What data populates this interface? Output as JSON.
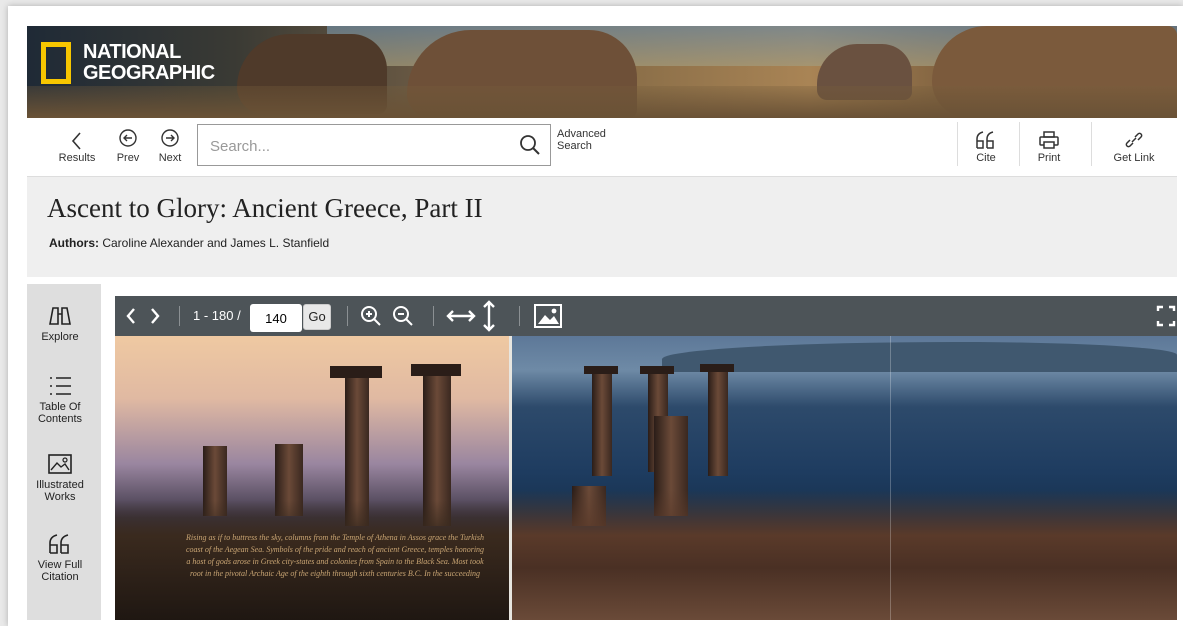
{
  "brand": {
    "line1": "NATIONAL",
    "line2": "GEOGRAPHIC"
  },
  "toolbar": {
    "results_label": "Results",
    "prev_label": "Prev",
    "next_label": "Next",
    "search_placeholder": "Search...",
    "advanced_line1": "Advanced",
    "advanced_line2": "Search",
    "cite_label": "Cite",
    "print_label": "Print",
    "getlink_label": "Get Link"
  },
  "document": {
    "title": "Ascent to Glory: Ancient Greece, Part II",
    "authors_label": "Authors:",
    "authors_value": "Caroline Alexander and James L. Stanfield"
  },
  "sidebar": {
    "items": [
      {
        "label": "Explore"
      },
      {
        "label": "Table Of Contents"
      },
      {
        "label": "Illustrated Works"
      },
      {
        "label": "View Full Citation"
      }
    ]
  },
  "viewer": {
    "range_text": "1 - 180 /",
    "page_value": "140",
    "go_label": "Go",
    "caption": "Rising as if to buttress the sky, columns from the Temple of Athena in Assos grace the Turkish coast of the Aegean Sea. Symbols of the pride and reach of ancient Greece, temples honoring a host of gods arose in Greek city-states and colonies from Spain to the Black Sea. Most took root in the pivotal Archaic Age of the eighth through sixth centuries B.C. In the succeeding"
  },
  "icons": {
    "results": "chevron-left-icon",
    "prev": "circle-arrow-left-icon",
    "next": "circle-arrow-right-icon",
    "search": "magnifier-icon",
    "cite": "quote-icon",
    "print": "printer-icon",
    "getlink": "link-icon",
    "explore": "binoculars-icon",
    "toc": "list-icon",
    "illustrated": "image-icon",
    "citation": "quote-icon",
    "zoom_in": "zoom-in-icon",
    "zoom_out": "zoom-out-icon",
    "fit_width": "horizontal-arrows-icon",
    "fit_height": "vertical-arrows-icon",
    "image_view": "image-icon",
    "fullscreen": "fullscreen-icon"
  },
  "colors": {
    "logo_yellow": "#f7c600",
    "viewer_toolbar": "#4d5458",
    "sidebar": "#dedede"
  }
}
